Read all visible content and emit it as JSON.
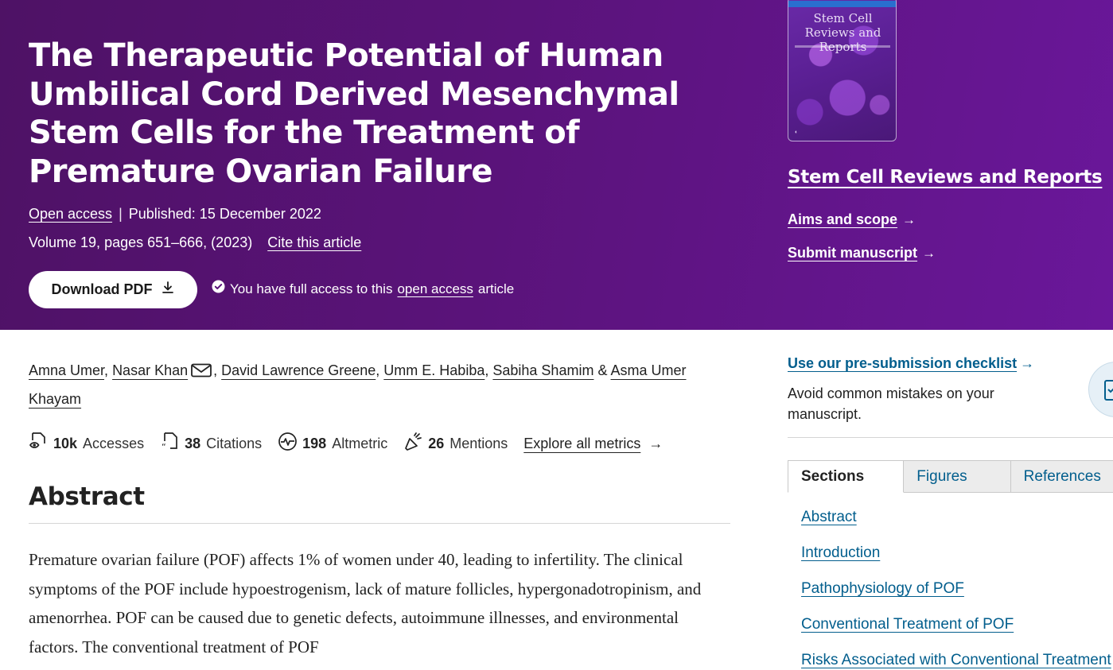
{
  "article": {
    "title": "The Therapeutic Potential of Human Umbilical Cord Derived Mesenchymal Stem Cells for the Treatment of Premature Ovarian Failure",
    "open_access": "Open access",
    "separator": "|",
    "published": "Published: 15 December 2022",
    "volume": "Volume 19, pages 651–666, (2023)",
    "cite_label": "Cite this article",
    "download_label": "Download PDF",
    "access_prefix": "You have full access to this",
    "access_link": "open access",
    "access_suffix": "article"
  },
  "journal": {
    "cover_title": "Stem Cell Reviews and Reports",
    "name": "Stem Cell Reviews and Reports",
    "aims_label": "Aims and scope",
    "submit_label": "Submit manuscript"
  },
  "authors": {
    "list": [
      "Amna Umer",
      "Nasar Khan",
      "David Lawrence Greene",
      "Umm E. Habiba",
      "Sabiha Shamim",
      "Asma Umer Khayam"
    ],
    "comma": ",",
    "ampersand": "&"
  },
  "metrics": {
    "accesses": {
      "value": "10k",
      "label": "Accesses"
    },
    "citations": {
      "value": "38",
      "label": "Citations"
    },
    "altmetric": {
      "value": "198",
      "label": "Altmetric"
    },
    "mentions": {
      "value": "26",
      "label": "Mentions"
    },
    "explore_label": "Explore all metrics"
  },
  "abstract": {
    "heading": "Abstract",
    "text": "Premature ovarian failure (POF) affects 1% of women under 40, leading to infertility. The clinical symptoms of the POF include hypoestrogenism, lack of mature follicles, hypergonadotropinism, and amenorrhea. POF can be caused due to genetic defects, autoimmune illnesses, and environmental factors. The conventional treatment of POF"
  },
  "sidebar": {
    "checklist_label": "Use our pre-submission checklist",
    "checklist_desc": "Avoid common mistakes on your manuscript.",
    "tabs": [
      "Sections",
      "Figures",
      "References"
    ],
    "toc": [
      "Abstract",
      "Introduction",
      "Pathophysiology of POF",
      "Conventional Treatment of POF",
      "Risks Associated with Conventional Treatment"
    ]
  },
  "colors": {
    "hero_purple": "#5a137a",
    "link_blue": "#025e8d"
  }
}
